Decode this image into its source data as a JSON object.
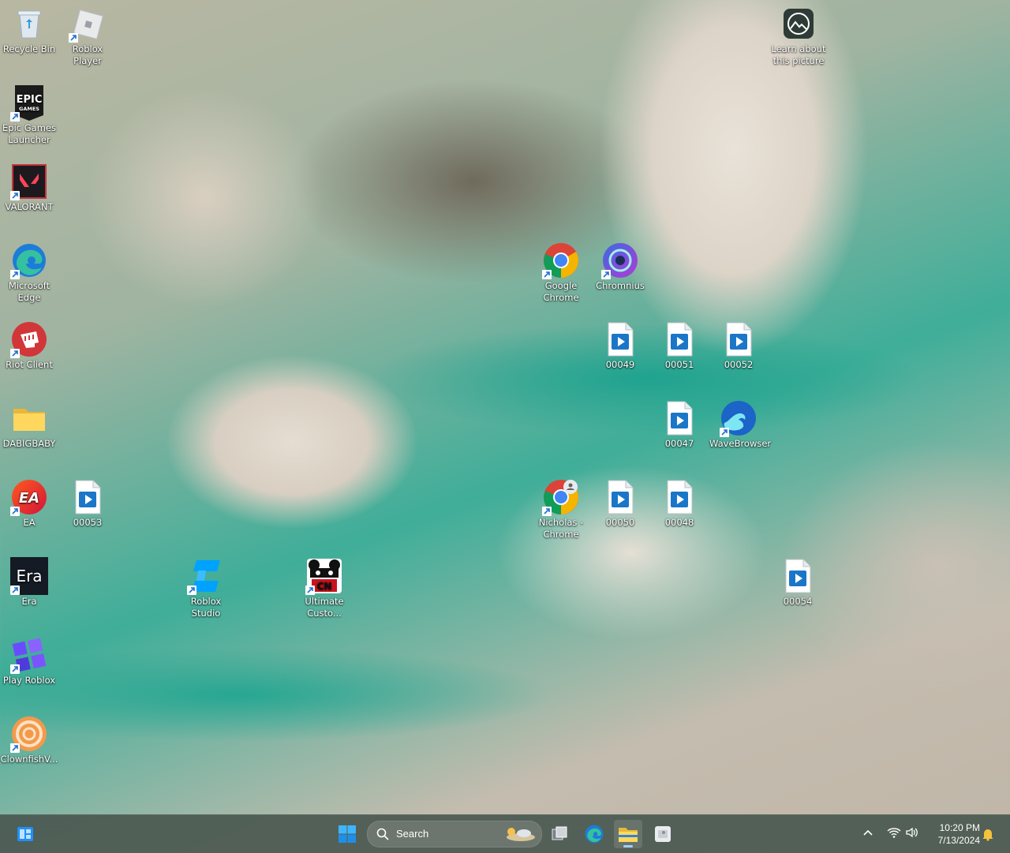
{
  "desktop": {
    "icons": [
      {
        "label": "Recycle Bin"
      },
      {
        "label": "Roblox Player"
      },
      {
        "label": "Epic Games Launcher"
      },
      {
        "label": "VALORANT"
      },
      {
        "label": "Microsoft Edge"
      },
      {
        "label": "Riot Client"
      },
      {
        "label": "DABIGBABY"
      },
      {
        "label": "EA"
      },
      {
        "label": "00053"
      },
      {
        "label": "Era"
      },
      {
        "label": "Roblox Studio"
      },
      {
        "label": "Ultimate Custo..."
      },
      {
        "label": "Play Roblox"
      },
      {
        "label": "ClownfishV..."
      },
      {
        "label": "Learn about this picture"
      },
      {
        "label": "Google Chrome"
      },
      {
        "label": "Chromnius"
      },
      {
        "label": "00049"
      },
      {
        "label": "00051"
      },
      {
        "label": "00052"
      },
      {
        "label": "00047"
      },
      {
        "label": "WaveBrowser"
      },
      {
        "label": "Nicholas - Chrome"
      },
      {
        "label": "00050"
      },
      {
        "label": "00048"
      },
      {
        "label": "00054"
      }
    ]
  },
  "taskbar": {
    "search_placeholder": "Search",
    "time": "10:20 PM",
    "date": "7/13/2024",
    "accent": "#1e90ff"
  }
}
